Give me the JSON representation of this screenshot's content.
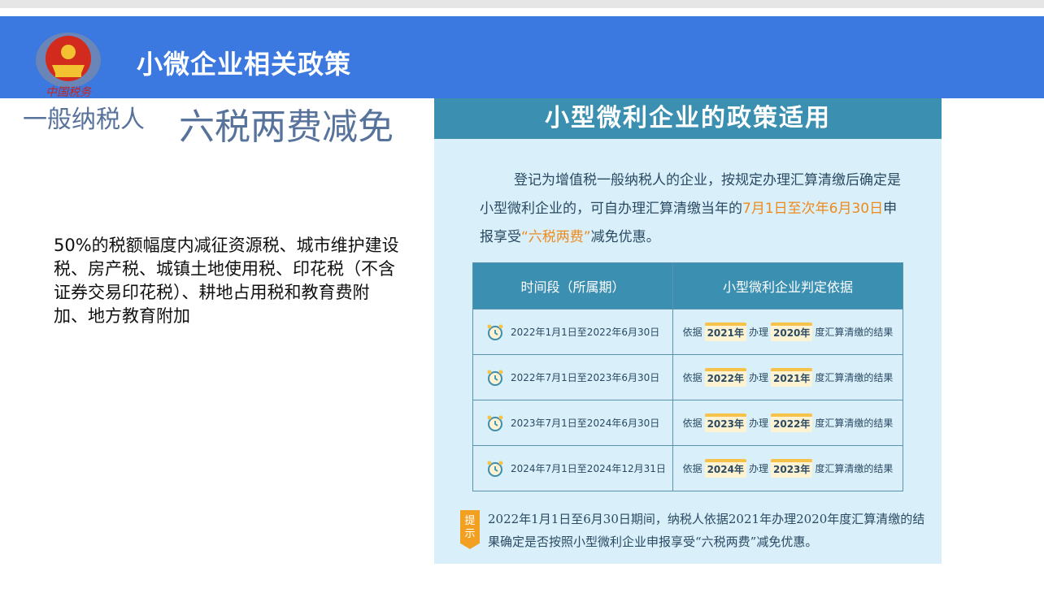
{
  "header": {
    "title": "小微企业相关政策",
    "emblem_icon": "tax-emblem-icon",
    "emblem_text": "中国税务"
  },
  "tags": {
    "taxpayer": "一般纳税人",
    "policy": "六税两费减免"
  },
  "body": {
    "text": "50%的税额幅度内减征资源税、城市维护建设税、房产税、城镇土地使用税、印花税（不含证券交易印花税）、耕地占用税和教育费附加、地方教育附加"
  },
  "poster": {
    "title": "小型微利企业的政策适用",
    "intro_before": "登记为增值税一般纳税人的企业，按规定办理汇算清缴后确定是小型微利企业的，可自办理汇算清缴当年的",
    "intro_date": "7月1日至次年6月30日",
    "intro_mid": "申报享受",
    "intro_policy": "“六税两费”",
    "intro_after": "减免优惠。",
    "table": {
      "headers": [
        "时间段（所属期）",
        "小型微利企业判定依据"
      ],
      "rows": [
        {
          "period": "2022年1月1日至2022年6月30日",
          "prefix": "依据",
          "year_a": "2021年",
          "middle": "办理",
          "year_b": "2020年",
          "suffix": "度汇算清缴的结果"
        },
        {
          "period": "2022年7月1日至2023年6月30日",
          "prefix": "依据",
          "year_a": "2022年",
          "middle": "办理",
          "year_b": "2021年",
          "suffix": "度汇算清缴的结果"
        },
        {
          "period": "2023年7月1日至2024年6月30日",
          "prefix": "依据",
          "year_a": "2023年",
          "middle": "办理",
          "year_b": "2022年",
          "suffix": "度汇算清缴的结果"
        },
        {
          "period": "2024年7月1日至2024年12月31日",
          "prefix": "依据",
          "year_a": "2024年",
          "middle": "办理",
          "year_b": "2023年",
          "suffix": "度汇算清缴的结果"
        }
      ]
    },
    "tip_badge": "提示",
    "tip_text": "2022年1月1日至6月30日期间，纳税人依据2021年办理2020年度汇算清缴的结果确定是否按照小型微利企业申报享受“六税两费”减免优惠。"
  },
  "colors": {
    "header_blue": "#3b78e0",
    "poster_bg": "#d9effa",
    "poster_teal": "#3b8fb0",
    "highlight_orange": "#ee8a1a",
    "year_badge_yellow": "#f6c24a"
  }
}
